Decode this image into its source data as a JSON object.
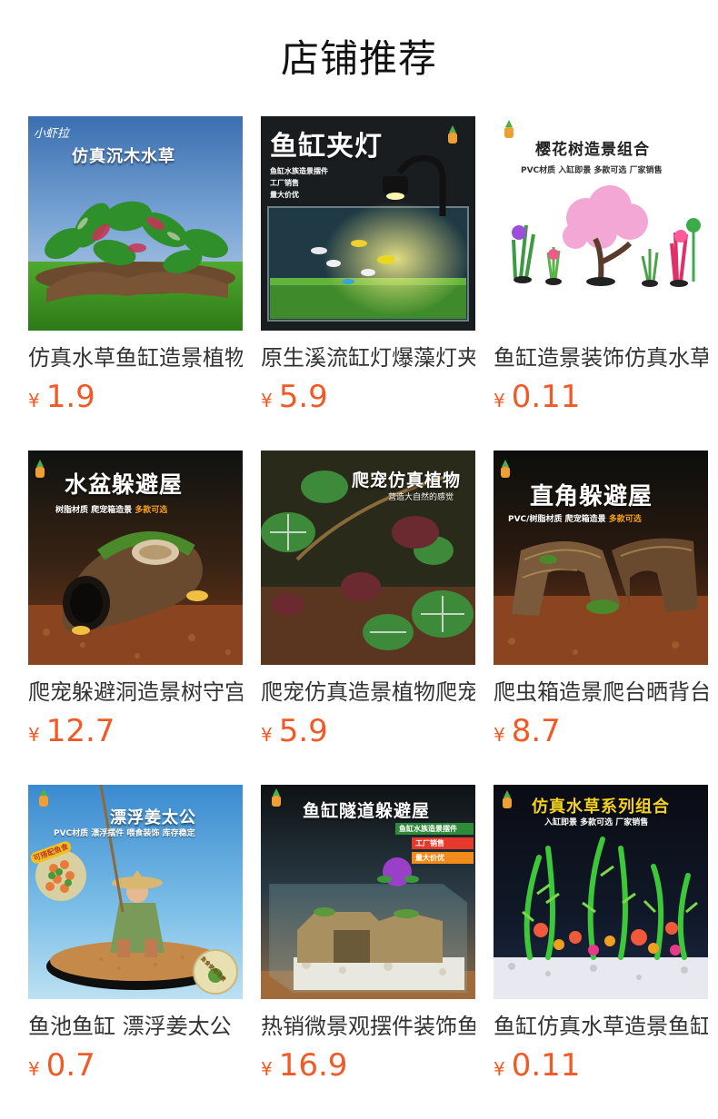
{
  "section_title": "店铺推荐",
  "currency_symbol": "¥",
  "products": [
    {
      "name": "仿真水草鱼缸造景植物",
      "price": "1.9",
      "image": {
        "overlay_title": "仿真沉木水草",
        "brand": "小虾拉"
      }
    },
    {
      "name": "原生溪流缸灯爆藻灯夹",
      "price": "5.9",
      "image": {
        "overlay_title": "鱼缸夹灯",
        "lines": "鱼缸水族造景摆件\n工厂销售\n量大价优"
      }
    },
    {
      "name": "鱼缸造景装饰仿真水草",
      "price": "0.11",
      "image": {
        "overlay_title": "樱花树造景组合",
        "subtitle": "PVC材质 入缸即景 多款可选 厂家销售"
      }
    },
    {
      "name": "爬宠躲避洞造景树守宫",
      "price": "12.7",
      "image": {
        "overlay_title": "水盆躲避屋",
        "subtitle_white": "树脂材质 爬宠箱造景",
        "subtitle_accent": "多款可选"
      }
    },
    {
      "name": "爬宠仿真造景植物爬宠",
      "price": "5.9",
      "image": {
        "overlay_title": "爬宠仿真植物",
        "subtitle": "营造大自然的感觉"
      }
    },
    {
      "name": "爬虫箱造景爬台晒背台",
      "price": "8.7",
      "image": {
        "overlay_title": "直角躲避屋",
        "subtitle_white": "PVC/树脂材质 爬宠箱造景",
        "subtitle_accent": "多款可选"
      }
    },
    {
      "name": "鱼池鱼缸 漂浮姜太公",
      "price": "0.7",
      "image": {
        "overlay_title": "漂浮姜太公",
        "subtitle": "PVC材质 漂浮摆件 喂食装饰 库存稳定",
        "side_badge": "可搭配鱼食",
        "corner_badge": "鱼食使用场景"
      }
    },
    {
      "name": "热销微景观摆件装饰鱼",
      "price": "16.9",
      "image": {
        "overlay_title": "鱼缸隧道躲避屋",
        "tags": [
          "鱼缸水族造景摆件",
          "工厂销售",
          "量大价优"
        ]
      }
    },
    {
      "name": "鱼缸仿真水草造景鱼缸",
      "price": "0.11",
      "image": {
        "overlay_title": "仿真水草系列组合",
        "subtitle": "入缸即景 多款可选 厂家销售"
      }
    }
  ],
  "colors": {
    "price": "#f15a24",
    "accent_orange": "#f6a21c",
    "tag_green": "#2e8b3a",
    "tag_red": "#e6392b",
    "tag_orange": "#f08b1c"
  }
}
